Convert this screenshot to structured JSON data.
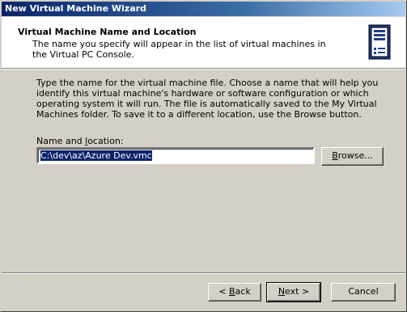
{
  "window": {
    "title": "New Virtual Machine Wizard"
  },
  "header": {
    "title": "Virtual Machine Name and Location",
    "description": "The name you specify will appear in the list of virtual machines in the Virtual PC Console.",
    "icon": "virtual-pc-tower-icon"
  },
  "body": {
    "instructions": "Type the name for the virtual machine file. Choose a name that will help you identify this virtual machine's hardware or software configuration or which operating system it will run. The file is automatically saved to the My Virtual Machines folder. To save it to a different location, use the Browse button."
  },
  "name_field": {
    "label_pre": "Name and ",
    "label_accel": "l",
    "label_post": "ocation:",
    "value": "C:\\dev\\az\\Azure Dev.vmc"
  },
  "buttons": {
    "browse_accel": "B",
    "browse_rest": "rowse...",
    "back_prefix": "< ",
    "back_accel": "B",
    "back_rest": "ack",
    "next_accel": "N",
    "next_rest": "ext >",
    "cancel": "Cancel"
  }
}
